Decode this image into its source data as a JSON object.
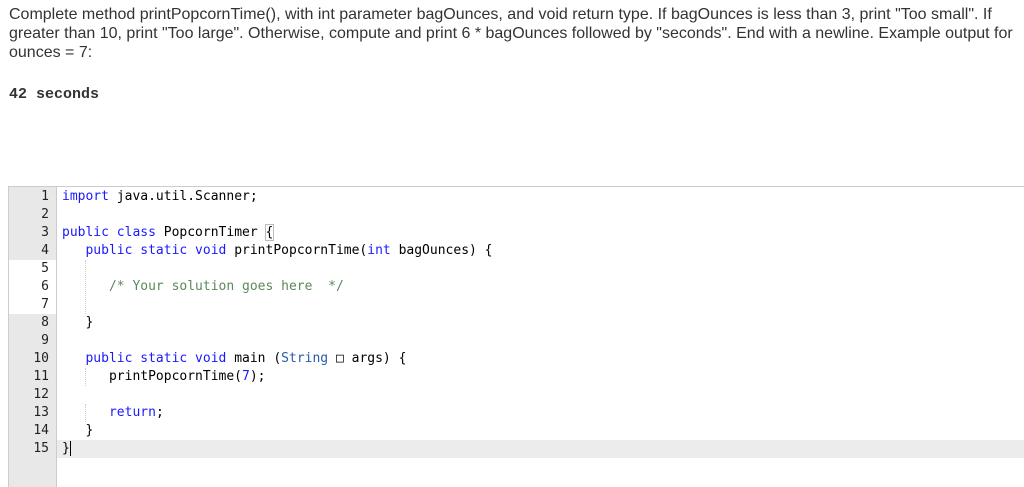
{
  "prompt": "Complete method printPopcornTime(), with int parameter bagOunces, and void return type. If bagOunces is less than 3, print \"Too small\". If greater than 10, print \"Too large\". Otherwise, compute and print 6 * bagOunces followed by \"seconds\". End with a newline. Example output for ounces = 7:",
  "example_output": "42 seconds",
  "editor": {
    "line_numbers": [
      "1",
      "2",
      "3",
      "4",
      "5",
      "6",
      "7",
      "8",
      "9",
      "10",
      "11",
      "12",
      "13",
      "14",
      "15"
    ],
    "lines": [
      [
        {
          "t": "import",
          "c": "kw"
        },
        {
          "t": " java.util.Scanner;",
          "c": ""
        }
      ],
      [],
      [
        {
          "t": "public class",
          "c": "kw"
        },
        {
          "t": " PopcornTimer ",
          "c": ""
        },
        {
          "t": "{",
          "c": "bracket"
        }
      ],
      [
        {
          "t": "   ",
          "c": ""
        },
        {
          "t": "public static void",
          "c": "kw"
        },
        {
          "t": " printPopcornTime(",
          "c": ""
        },
        {
          "t": "int",
          "c": "kw"
        },
        {
          "t": " bagOunces) {",
          "c": ""
        }
      ],
      [],
      [
        {
          "t": "      ",
          "c": ""
        },
        {
          "t": "/* Your solution goes here  */",
          "c": "cm"
        }
      ],
      [],
      [
        {
          "t": "   }",
          "c": ""
        }
      ],
      [],
      [
        {
          "t": "   ",
          "c": ""
        },
        {
          "t": "public static void",
          "c": "kw"
        },
        {
          "t": " main (",
          "c": ""
        },
        {
          "t": "String",
          "c": "ty"
        },
        {
          "t": " □ args) {",
          "c": ""
        }
      ],
      [
        {
          "t": "      printPopcornTime(",
          "c": ""
        },
        {
          "t": "7",
          "c": "num"
        },
        {
          "t": ");",
          "c": ""
        }
      ],
      [],
      [
        {
          "t": "      ",
          "c": ""
        },
        {
          "t": "return",
          "c": "kw"
        },
        {
          "t": ";",
          "c": ""
        }
      ],
      [
        {
          "t": "   }",
          "c": ""
        }
      ],
      [
        {
          "t": "}",
          "c": ""
        },
        {
          "t": "",
          "c": "cursor"
        }
      ]
    ]
  }
}
